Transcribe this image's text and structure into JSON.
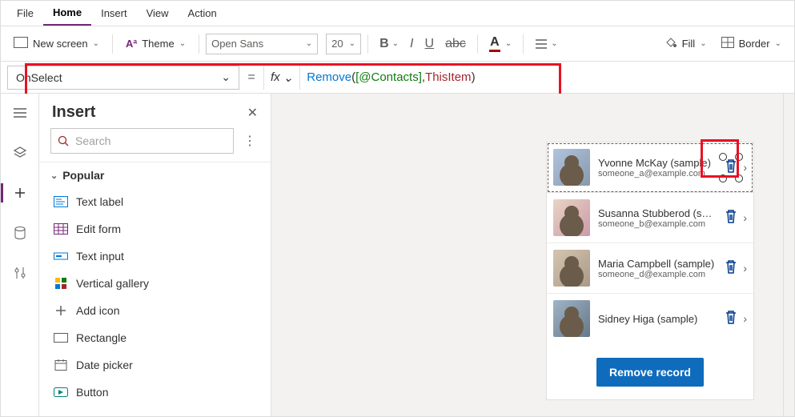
{
  "menu": {
    "items": [
      "File",
      "Home",
      "Insert",
      "View",
      "Action"
    ],
    "active": "Home"
  },
  "ribbon": {
    "new_screen": "New screen",
    "theme": "Theme",
    "font": "Open Sans",
    "size": "20",
    "bold": "B",
    "italic": "I",
    "underline": "U",
    "fontcolor": "A",
    "fill": "Fill",
    "border": "Border"
  },
  "formula": {
    "property": "OnSelect",
    "fx": "fx",
    "tokens": {
      "func": "Remove",
      "open": "(",
      "sp1": " ",
      "ds": "[@Contacts]",
      "comma": ",",
      "sp2": " ",
      "arg": "ThisItem",
      "sp3": " ",
      "close": ")"
    }
  },
  "insert_panel": {
    "title": "Insert",
    "search_placeholder": "Search",
    "section": "Popular",
    "items": [
      "Text label",
      "Edit form",
      "Text input",
      "Vertical gallery",
      "Add icon",
      "Rectangle",
      "Date picker",
      "Button"
    ]
  },
  "gallery": {
    "rows": [
      {
        "name": "Yvonne McKay (sample)",
        "email": "someone_a@example.com"
      },
      {
        "name": "Susanna Stubberod (sample)",
        "email": "someone_b@example.com"
      },
      {
        "name": "Maria Campbell (sample)",
        "email": "someone_d@example.com"
      },
      {
        "name": "Sidney Higa (sample)",
        "email": ""
      }
    ],
    "button": "Remove record"
  }
}
